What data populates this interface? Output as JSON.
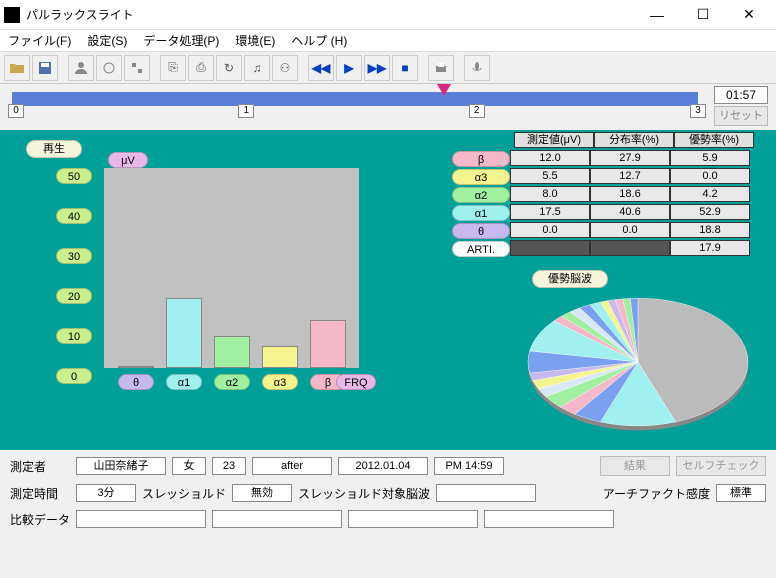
{
  "window": {
    "title": "パルラックスライト"
  },
  "menu": {
    "file": "ファイル(F)",
    "settings": "設定(S)",
    "data": "データ処理(P)",
    "env": "環境(E)",
    "help": "ヘルプ (H)"
  },
  "progress": {
    "time": "01:57",
    "reset": "リセット",
    "ticks": [
      "0",
      "1",
      "2",
      "3"
    ]
  },
  "labels": {
    "play": "再生",
    "uv": "μV",
    "frq": "FRQ",
    "pie_title": "優勢脳波"
  },
  "chart_data": {
    "type": "bar",
    "ylabel": "μV",
    "xlabel": "FRQ",
    "ylim": [
      0,
      50
    ],
    "yticks": [
      50,
      40,
      30,
      20,
      10,
      0
    ],
    "categories": [
      "θ",
      "α1",
      "α2",
      "α3",
      "β"
    ],
    "values": [
      0.0,
      17.5,
      8.0,
      5.5,
      12.0
    ],
    "colors": [
      "#c8b8f0",
      "#a0f0f0",
      "#a0f0a0",
      "#f5f590",
      "#f5b8c8"
    ]
  },
  "table": {
    "headers": [
      "測定値(μV)",
      "分布率(%)",
      "優勢率(%)"
    ],
    "rows": [
      {
        "label": "β",
        "color": "#f5b8c8",
        "vals": [
          "12.0",
          "27.9",
          "5.9"
        ]
      },
      {
        "label": "α3",
        "color": "#f5f590",
        "vals": [
          "5.5",
          "12.7",
          "0.0"
        ]
      },
      {
        "label": "α2",
        "color": "#a0f0a0",
        "vals": [
          "8.0",
          "18.6",
          "4.2"
        ]
      },
      {
        "label": "α1",
        "color": "#a0f0f0",
        "vals": [
          "17.5",
          "40.6",
          "52.9"
        ]
      },
      {
        "label": "θ",
        "color": "#c8b8f0",
        "vals": [
          "0.0",
          "0.0",
          "18.8"
        ]
      },
      {
        "label": "ARTI.",
        "color": "#ffffff",
        "vals": [
          "",
          "",
          "17.9"
        ],
        "dark": true
      }
    ]
  },
  "pie_data": {
    "type": "pie",
    "title": "優勢脳波",
    "note": "many thin slices; dominant large gray slice ~45%, cyan group ~25%, assorted small colored slices remainder"
  },
  "info": {
    "measurer_lbl": "測定者",
    "name": "山田奈緒子",
    "sex": "女",
    "age": "23",
    "phase": "after",
    "date": "2012.01.04",
    "time": "PM 14:59",
    "result_btn": "結果",
    "selfcheck_btn": "セルフチェック",
    "meastime_lbl": "測定時間",
    "meastime": "3分",
    "threshold_lbl": "スレッショルド",
    "threshold": "無効",
    "threshold_target_lbl": "スレッショルド対象脳波",
    "threshold_target": "",
    "artifact_lbl": "アーチファクト感度",
    "artifact": "標準",
    "compare_lbl": "比較データ"
  }
}
